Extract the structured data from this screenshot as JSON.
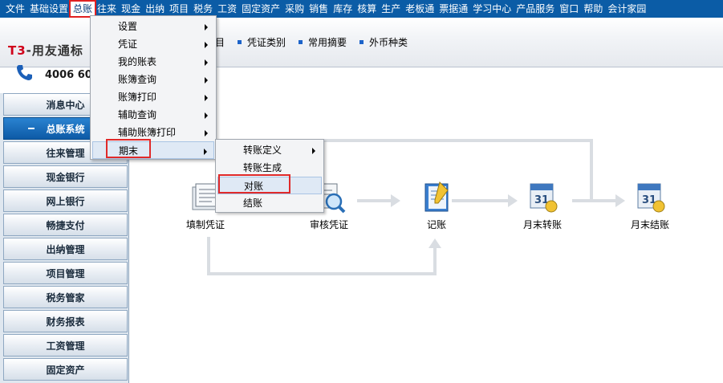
{
  "menubar": {
    "items": [
      "文件",
      "基础设置",
      "总账",
      "往来",
      "现金",
      "出纳",
      "项目",
      "税务",
      "工资",
      "固定资产",
      "采购",
      "销售",
      "库存",
      "核算",
      "生产",
      "老板通",
      "票据通",
      "学习中心",
      "产品服务",
      "窗口",
      "帮助",
      "会计家园"
    ],
    "active_index": 2
  },
  "logo": {
    "title_prefix": "T3",
    "title_rest": "-用友通标",
    "phone": "4006 600"
  },
  "toolbar": {
    "items": [
      "目",
      "凭证类别",
      "常用摘要",
      "外币种类"
    ]
  },
  "sidebar": {
    "items": [
      "消息中心",
      "总账系统",
      "往来管理",
      "现金银行",
      "网上银行",
      "畅捷支付",
      "出纳管理",
      "项目管理",
      "税务管家",
      "财务报表",
      "工资管理",
      "固定资产"
    ],
    "selected_index": 1
  },
  "flow": {
    "nodes": [
      "填制凭证",
      "审核凭证",
      "记账",
      "月末转账",
      "月末结账"
    ]
  },
  "menu_main": {
    "items": [
      "设置",
      "凭证",
      "我的账表",
      "账簿查询",
      "账簿打印",
      "辅助查询",
      "辅助账簿打印",
      "期末"
    ],
    "has_submenu": [
      true,
      true,
      true,
      true,
      true,
      true,
      true,
      true
    ],
    "highlighted_index": 7
  },
  "menu_sub": {
    "items": [
      "转账定义",
      "转账生成",
      "对账",
      "结账"
    ],
    "has_submenu": [
      true,
      false,
      false,
      false
    ],
    "highlighted_index": 2
  }
}
